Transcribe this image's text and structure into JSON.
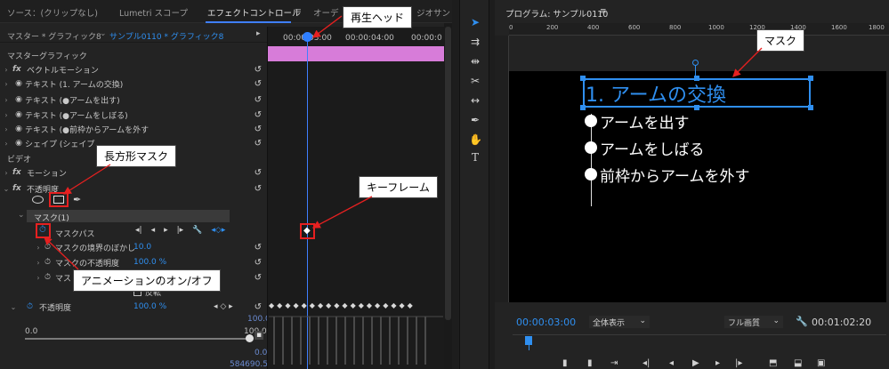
{
  "left_panel": {
    "tabs": [
      "ソース：(クリップなし)",
      "Lumetri スコープ",
      "エフェクトコントロール",
      "≡",
      "オーデ",
      "ジオサン"
    ],
    "sequence": {
      "master": "マスター * グラフィック8",
      "clip": "サンプル0110 * グラフィック8"
    },
    "timecodes": [
      "00:00:03:00",
      "00:00:04:00",
      "00:00:0"
    ],
    "section_master": "マスターグラフィック",
    "items": [
      "ベクトルモーション",
      "テキスト (1. アームの交換)",
      "テキスト (●アームを出す)",
      "テキスト (●アームをしぼる)",
      "テキスト (●前枠からアームを外す",
      "シェイプ (シェイプ"
    ],
    "section_video": "ビデオ",
    "motion": "モーション",
    "opacity": "不透明度",
    "mask_name": "マスク(1)",
    "mask_path": "マスクパス",
    "mask_feather_label": "マスクの境界のぼかし",
    "mask_feather_value": "10.0",
    "mask_opacity_label": "マスクの不透明度",
    "mask_opacity_value": "100.0 %",
    "mask_expansion_label": "マス",
    "invert_label": "反転",
    "opacity_label": "不透明度",
    "opacity_value": "100.0 %",
    "graph_values": [
      "100.0",
      "0.0",
      "100.0",
      "0.0",
      "584690.5"
    ]
  },
  "callouts": {
    "playhead": "再生ヘッド",
    "keyframe": "キーフレーム",
    "rect_mask": "長方形マスク",
    "animation_toggle": "アニメーションのオン/オフ",
    "mask": "マスク"
  },
  "program": {
    "title": "プログラム: サンプル0110",
    "menu": "≡",
    "ruler_labels": [
      "0",
      "200",
      "400",
      "600",
      "800",
      "1000",
      "1200",
      "1400",
      "1600",
      "1800"
    ],
    "slide_title": "1. アームの交換",
    "bullets": [
      "アームを出す",
      "アームをしばる",
      "前枠からアームを外す"
    ],
    "timecode_current": "00:00:03:00",
    "zoom": "全体表示",
    "quality": "フル画質",
    "timecode_duration": "00:01:02:20"
  },
  "colors": {
    "accent": "#2f8ff0",
    "pink_clip": "#d77cd9",
    "callout_red": "#e62020"
  }
}
